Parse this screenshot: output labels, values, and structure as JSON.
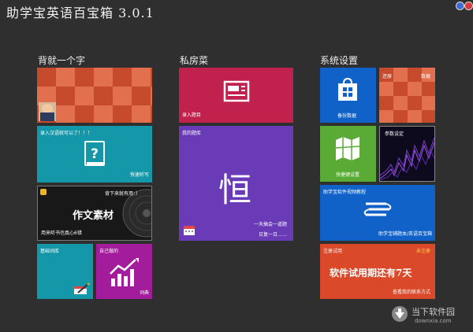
{
  "app": {
    "title": "助学宝英语百宝箱  3.0.1"
  },
  "sections": {
    "left": "背就一个字",
    "middle": "私房菜",
    "right": "系统设置"
  },
  "tiles": {
    "dictation": {
      "top": "录入汉语就可以了！！！",
      "bottom": "快速听写"
    },
    "composition": {
      "top_right": "背下来就有用：）",
      "main": "作文素材",
      "bottom": "用来听书也真心6错"
    },
    "basic_vocab": {
      "label": "基础词库"
    },
    "my_dict": {
      "top": "自己做的",
      "bottom": "词典"
    },
    "enter_exam": {
      "label": "录入题目"
    },
    "my_exam": {
      "top": "我的题库",
      "glyph": "恒",
      "line1": "一天搞会一道题",
      "line2": "日复一日……"
    },
    "backup": {
      "label": "备份数据"
    },
    "restore": {
      "left": "还原",
      "right": "数据"
    },
    "shortcut": {
      "label": "快捷键设置"
    },
    "params": {
      "label": "参数设定"
    },
    "video": {
      "top": "助学宝软件视频教程",
      "bottom": "助学宝辅题本/英语百宝箱"
    },
    "trial": {
      "top_left": "注册试用",
      "top_right": "未注册",
      "main": "软件试用期还有7天",
      "bottom": "查看我的联系方式"
    }
  },
  "watermark": {
    "name": "当下软件园",
    "url": "downxia.com"
  },
  "colors": {
    "background": "#2f2f30",
    "orange": "#d95a3a",
    "teal": "#1497a8",
    "magenta": "#a31c9b",
    "crimson": "#c0214d",
    "purple": "#6a3bb7",
    "blue": "#1061c8",
    "green": "#5aaa36",
    "red_orange": "#d9492a"
  }
}
